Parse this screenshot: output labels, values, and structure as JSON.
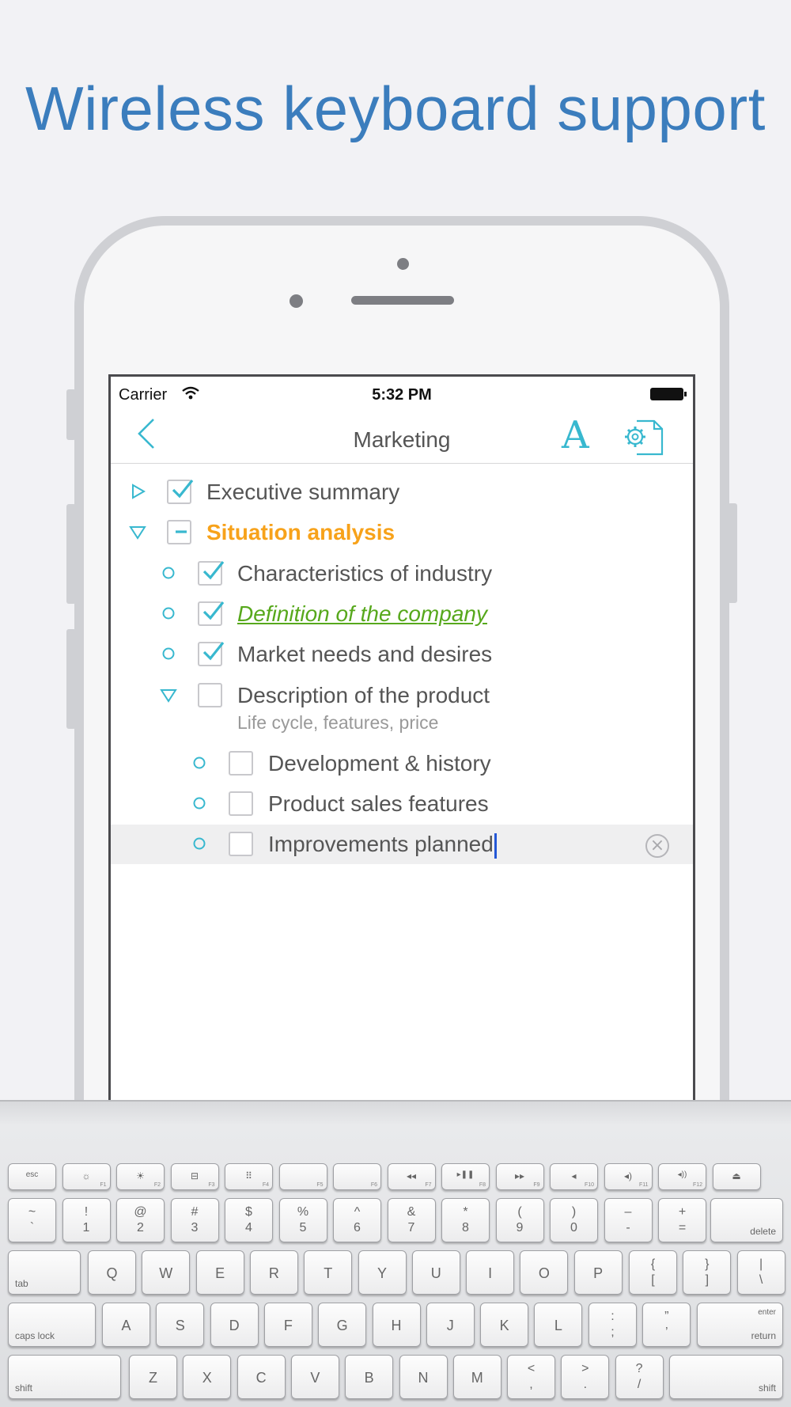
{
  "headline": "Wireless keyboard support",
  "status_bar": {
    "carrier": "Carrier",
    "time": "5:32 PM"
  },
  "nav": {
    "back_icon": "chevron-left-icon",
    "title": "Marketing",
    "font_label": "A",
    "settings_icon": "document-gear-icon"
  },
  "outline": [
    {
      "label": "Executive summary",
      "marker": "triangle-right",
      "checked": "checked",
      "style": "normal"
    },
    {
      "label": "Situation analysis",
      "marker": "triangle-down",
      "checked": "partial",
      "style": "orange-bold"
    },
    {
      "label": "Characteristics of industry",
      "marker": "circle",
      "checked": "checked",
      "style": "normal"
    },
    {
      "label": "Definition of the company",
      "marker": "circle",
      "checked": "checked",
      "style": "green-italic-underline"
    },
    {
      "label": "Market needs and desires",
      "marker": "circle",
      "checked": "checked",
      "style": "normal"
    },
    {
      "label": "Description of the product",
      "note": "Life cycle, features, price",
      "marker": "triangle-down",
      "checked": "unchecked",
      "style": "normal"
    },
    {
      "label": "Development & history",
      "marker": "circle",
      "checked": "unchecked",
      "style": "normal"
    },
    {
      "label": "Product sales features",
      "marker": "circle",
      "checked": "unchecked",
      "style": "normal"
    },
    {
      "label": "Improvements planned",
      "marker": "circle",
      "checked": "unchecked",
      "style": "normal",
      "editing": true
    }
  ],
  "colors": {
    "accent": "#38b8cf",
    "headline": "#3b7dbd",
    "orange": "#f7a21a",
    "green": "#57a81c"
  },
  "keyboard": {
    "fn_row": [
      {
        "main": "esc",
        "sub": ""
      },
      {
        "main": "☼",
        "sub": "F1"
      },
      {
        "main": "☀",
        "sub": "F2"
      },
      {
        "main": "⊟",
        "sub": "F3"
      },
      {
        "main": "⠿",
        "sub": "F4"
      },
      {
        "main": "",
        "sub": "F5"
      },
      {
        "main": "",
        "sub": "F6"
      },
      {
        "main": "◂◂",
        "sub": "F7"
      },
      {
        "main": "▸❚❚",
        "sub": "F8"
      },
      {
        "main": "▸▸",
        "sub": "F9"
      },
      {
        "main": "◂",
        "sub": "F10"
      },
      {
        "main": "◂)",
        "sub": "F11"
      },
      {
        "main": "◂))",
        "sub": "F12"
      },
      {
        "main": "⏏",
        "sub": ""
      }
    ],
    "num_row": [
      {
        "top": "~",
        "bottom": "`"
      },
      {
        "top": "!",
        "bottom": "1"
      },
      {
        "top": "@",
        "bottom": "2"
      },
      {
        "top": "#",
        "bottom": "3"
      },
      {
        "top": "$",
        "bottom": "4"
      },
      {
        "top": "%",
        "bottom": "5"
      },
      {
        "top": "^",
        "bottom": "6"
      },
      {
        "top": "&",
        "bottom": "7"
      },
      {
        "top": "*",
        "bottom": "8"
      },
      {
        "top": "(",
        "bottom": "9"
      },
      {
        "top": ")",
        "bottom": "0"
      },
      {
        "top": "–",
        "bottom": "-"
      },
      {
        "top": "+",
        "bottom": "="
      }
    ],
    "delete": "delete",
    "tab": "tab",
    "q_row": [
      "Q",
      "W",
      "E",
      "R",
      "T",
      "Y",
      "U",
      "I",
      "O",
      "P"
    ],
    "q_row_sym": [
      {
        "top": "{",
        "bottom": "["
      },
      {
        "top": "}",
        "bottom": "]"
      },
      {
        "top": "|",
        "bottom": "\\"
      }
    ],
    "caps": "caps lock",
    "a_row": [
      "A",
      "S",
      "D",
      "F",
      "G",
      "H",
      "J",
      "K",
      "L"
    ],
    "a_row_sym": [
      {
        "top": ":",
        "bottom": ";"
      },
      {
        "top": "”",
        "bottom": "’"
      }
    ],
    "enter_top": "enter",
    "enter_bottom": "return",
    "shift": "shift",
    "z_row": [
      "Z",
      "X",
      "C",
      "V",
      "B",
      "N",
      "M"
    ],
    "z_row_sym": [
      {
        "top": "<",
        "bottom": ","
      },
      {
        "top": ">",
        "bottom": "."
      },
      {
        "top": "?",
        "bottom": "/"
      }
    ]
  }
}
